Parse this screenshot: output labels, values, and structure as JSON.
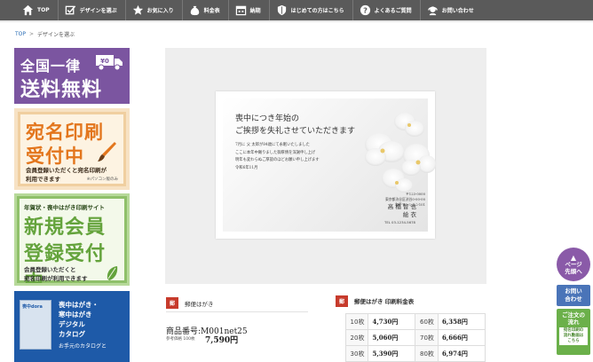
{
  "nav": {
    "items": [
      {
        "label": "TOP",
        "icon": "home-icon"
      },
      {
        "label": "デザインを選ぶ",
        "icon": "checkbox-pen-icon"
      },
      {
        "label": "お気に入り",
        "icon": "star-icon"
      },
      {
        "label": "料金表",
        "icon": "money-bag-icon"
      },
      {
        "label": "納期",
        "icon": "calendar-icon"
      },
      {
        "label": "はじめての方はこちら",
        "icon": "shield-icon"
      },
      {
        "label": "よくあるご質問",
        "icon": "question-icon"
      },
      {
        "label": "お問い合わせ",
        "icon": "headset-icon"
      }
    ]
  },
  "breadcrumb": {
    "home": "TOP",
    "separator": ">",
    "current": "デザインを選ぶ"
  },
  "side_banners": {
    "free_shipping": {
      "line1": "全国一律",
      "line2": "送料無料",
      "truck_label": "¥0"
    },
    "address_print": {
      "line1": "宛名印刷",
      "line2": "受付中",
      "note1": "会員登録いただくと宛名印刷が",
      "note2": "利用できます",
      "small": "※パソコン版のみ"
    },
    "new_member": {
      "header": "年賀状・喪中はがき印刷サイト",
      "line1": "新規会員",
      "line2": "登録受付中",
      "note1": "会員登録いただくと",
      "note2": "宛名印刷が利用できます"
    },
    "catalog": {
      "cover": "喪中dora",
      "line1": "喪中はがき・",
      "line2": "寒中はがき",
      "line3": "デジタル",
      "line4": "カタログ",
      "footer": "お手元のカタログと"
    }
  },
  "card": {
    "title1": "喪中につき年始の",
    "title2": "ご挨拶を失礼させていただきます",
    "body": [
      "7月に 父 太郎が84歳にて永眠いたしました",
      "ここに本年中賜りました御厚情を深謝申し上げ",
      "明年も変わらぬご厚誼のほどお願い申し上げます",
      "令和6年11月"
    ],
    "address": [
      "〒123-0000",
      "東京都渋谷区渋谷0-00-00",
      "和手マンション101"
    ],
    "names": [
      "高 橋 智 也",
      "絵 衣"
    ],
    "tel": "TEL 03-1234-5678"
  },
  "product": {
    "tag": "郵",
    "category": "郵便はがき",
    "number_label": "商品番号:",
    "number": "M001net25",
    "price_label": "参考価格 100枚",
    "price": "7,590円"
  },
  "price_table": {
    "tag": "郵",
    "title": "郵便はがき 印刷料金表",
    "rows": [
      {
        "q1": "10枚",
        "v1": "4,730円",
        "q2": "60枚",
        "v2": "6,358円"
      },
      {
        "q1": "20枚",
        "v1": "5,060円",
        "q2": "70枚",
        "v2": "6,666円"
      },
      {
        "q1": "30枚",
        "v1": "5,390円",
        "q2": "80枚",
        "v2": "6,974円"
      }
    ]
  },
  "floating": {
    "top_line1": "ページ",
    "top_line2": "先頭へ",
    "contact_line1": "お問い",
    "contact_line2": "合わせ",
    "order_line1": "ご注文の",
    "order_line2": "流れ",
    "order_sub1": "宛名印刷の",
    "order_sub2": "流れ動画は",
    "order_sub3": "こちら"
  }
}
